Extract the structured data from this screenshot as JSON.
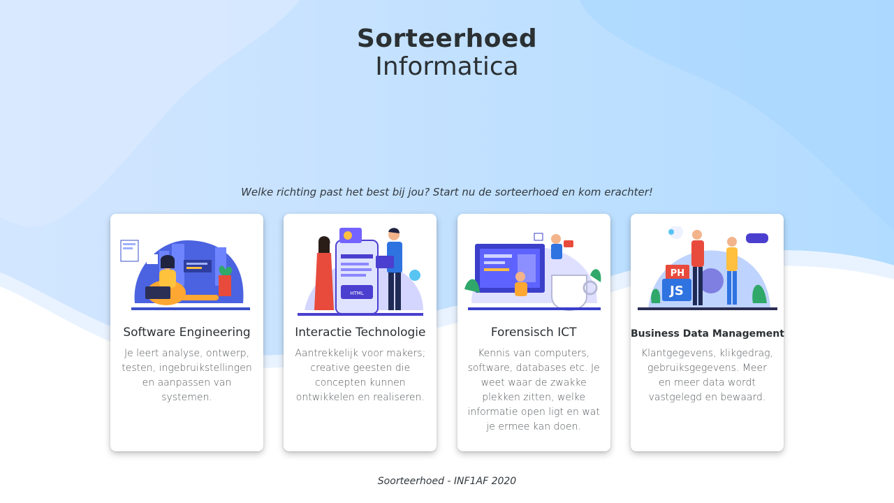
{
  "header": {
    "title_main": "Sorteerhoed",
    "title_sub": "Informatica"
  },
  "tagline": "Welke richting past het best bij jou? Start nu de sorteerhoed en kom erachter!",
  "cards": [
    {
      "title": "Software Engineering",
      "description": "Je leert analyse, ontwerp, testen, ingebruikstellingen en aanpassen van systemen.",
      "illustration": "developer-laptop-illustration"
    },
    {
      "title": "Interactie Technologie",
      "description": "Aantrekkelijk voor makers; creative geesten die concepten kunnen ontwikkelen en realiseren.",
      "illustration": "html-mobile-illustration",
      "html_badge": "HTML"
    },
    {
      "title": "Forensisch ICT",
      "description": "Kennis van computers, software, databases etc. Je weet waar de zwakke plekken zitten, welke informatie open ligt en wat je ermee kan doen.",
      "illustration": "monitor-coffee-illustration"
    },
    {
      "title": "Business Data Management",
      "description": "Klantgegevens, klikgedrag, gebruiksgegevens. Meer en meer data wordt vastgelegd en bewaard.",
      "illustration": "php-js-illustration",
      "php_badge": "PH",
      "js_badge": "JS"
    }
  ],
  "footer": "Soorteerhoed - INF1AF 2020",
  "colors": {
    "bg_light": "#cfe6ff",
    "bg_blue": "#b3dcff",
    "title": "#2b3033",
    "accent_purple": "#4b3fcf"
  }
}
